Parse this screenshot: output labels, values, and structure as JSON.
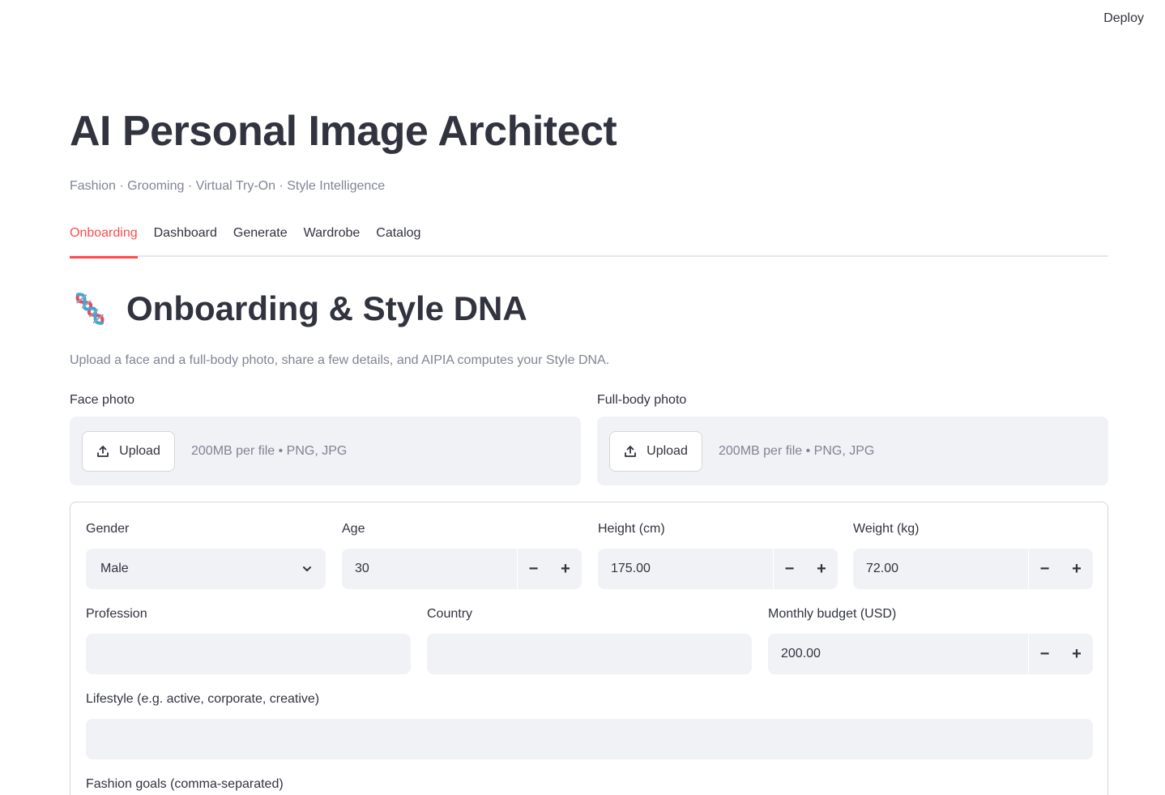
{
  "header": {
    "deploy_label": "Deploy"
  },
  "app": {
    "title": "AI Personal Image Architect",
    "subtitle": "Fashion · Grooming · Virtual Try-On · Style Intelligence"
  },
  "tabs": [
    {
      "label": "Onboarding",
      "active": true
    },
    {
      "label": "Dashboard",
      "active": false
    },
    {
      "label": "Generate",
      "active": false
    },
    {
      "label": "Wardrobe",
      "active": false
    },
    {
      "label": "Catalog",
      "active": false
    }
  ],
  "section": {
    "icon": "dna-icon",
    "title": "Onboarding & Style DNA",
    "description": "Upload a face and a full-body photo, share a few details, and AIPIA computes your Style DNA."
  },
  "uploads": {
    "face": {
      "label": "Face photo",
      "button": "Upload",
      "hint": "200MB per file • PNG, JPG"
    },
    "body": {
      "label": "Full-body photo",
      "button": "Upload",
      "hint": "200MB per file • PNG, JPG"
    }
  },
  "form": {
    "gender": {
      "label": "Gender",
      "value": "Male"
    },
    "age": {
      "label": "Age",
      "value": "30"
    },
    "height": {
      "label": "Height (cm)",
      "value": "175.00"
    },
    "weight": {
      "label": "Weight (kg)",
      "value": "72.00"
    },
    "profession": {
      "label": "Profession",
      "value": ""
    },
    "country": {
      "label": "Country",
      "value": ""
    },
    "budget": {
      "label": "Monthly budget (USD)",
      "value": "200.00"
    },
    "lifestyle": {
      "label": "Lifestyle (e.g. active, corporate, creative)",
      "value": ""
    },
    "goals": {
      "label": "Fashion goals (comma-separated)"
    }
  },
  "stepper": {
    "minus": "−",
    "plus": "+"
  },
  "colors": {
    "accent": "#ff4b4b",
    "input_bg": "#f0f2f6",
    "text": "#31333f",
    "muted": "#808495"
  }
}
